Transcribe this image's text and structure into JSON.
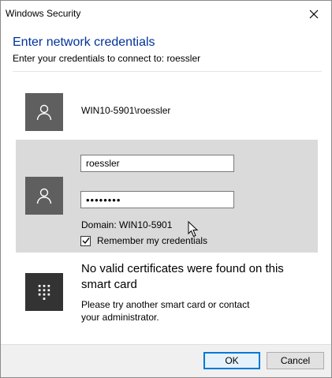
{
  "window": {
    "title": "Windows Security"
  },
  "dialog": {
    "heading": "Enter network credentials",
    "subheading": "Enter your credentials to connect to: roessler"
  },
  "accounts": [
    {
      "name": "WIN10-5901\\roessler",
      "icon": "user-icon"
    }
  ],
  "selected_account": {
    "icon": "user-icon",
    "username_value": "roessler",
    "password_value": "••••••••",
    "domain_text": "Domain: WIN10-5901",
    "remember_label": "Remember my credentials",
    "remember_checked": true
  },
  "smartcard": {
    "icon": "smartcard-keypad-icon",
    "title": "No valid certificates were found on this smart card",
    "description": "Please try another smart card or contact your administrator."
  },
  "buttons": {
    "ok": "OK",
    "cancel": "Cancel"
  },
  "colors": {
    "heading": "#003399",
    "tile": "#5f5f5f",
    "smartcard_tile": "#333333",
    "selected_panel": "#dadada",
    "ok_border": "#0078d7"
  }
}
